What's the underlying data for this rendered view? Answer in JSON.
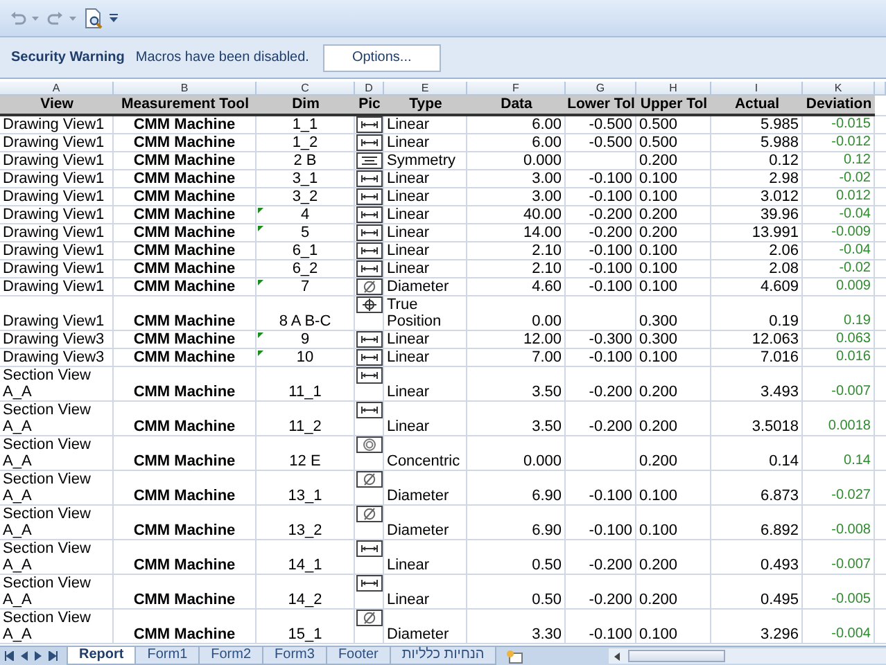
{
  "security_bar": {
    "title": "Security Warning",
    "message": "Macros have been disabled.",
    "button": "Options..."
  },
  "columns": [
    {
      "letter": "A",
      "heading": "View"
    },
    {
      "letter": "B",
      "heading": "Measurement Tool"
    },
    {
      "letter": "C",
      "heading": "Dim"
    },
    {
      "letter": "D",
      "heading": "Pic"
    },
    {
      "letter": "E",
      "heading": "Type"
    },
    {
      "letter": "F",
      "heading": "Data"
    },
    {
      "letter": "G",
      "heading": "Lower Tol"
    },
    {
      "letter": "H",
      "heading": "Upper Tol"
    },
    {
      "letter": "I",
      "heading": "Actual"
    },
    {
      "letter": "K",
      "heading": "Deviation"
    }
  ],
  "rows": [
    {
      "view": "Drawing View1",
      "tool": "CMM Machine",
      "dim": "1_1",
      "flag": false,
      "kind": "linear",
      "type": "Linear",
      "data": "6.00",
      "lower": "-0.500",
      "upper": "0.500",
      "actual": "5.985",
      "deviation": "-0.015"
    },
    {
      "view": "Drawing View1",
      "tool": "CMM Machine",
      "dim": "1_2",
      "flag": false,
      "kind": "linear",
      "type": "Linear",
      "data": "6.00",
      "lower": "-0.500",
      "upper": "0.500",
      "actual": "5.988",
      "deviation": "-0.012"
    },
    {
      "view": "Drawing View1",
      "tool": "CMM Machine",
      "dim": "2 B",
      "flag": false,
      "kind": "symmetry",
      "type": "Symmetry",
      "data": "0.000",
      "upper": "0.200",
      "actual": "0.12",
      "deviation": "0.12"
    },
    {
      "view": "Drawing View1",
      "tool": "CMM Machine",
      "dim": "3_1",
      "flag": false,
      "kind": "linear",
      "type": "Linear",
      "data": "3.00",
      "lower": "-0.100",
      "upper": "0.100",
      "actual": "2.98",
      "deviation": "-0.02"
    },
    {
      "view": "Drawing View1",
      "tool": "CMM Machine",
      "dim": "3_2",
      "flag": false,
      "kind": "linear",
      "type": "Linear",
      "data": "3.00",
      "lower": "-0.100",
      "upper": "0.100",
      "actual": "3.012",
      "deviation": "0.012"
    },
    {
      "view": "Drawing View1",
      "tool": "CMM Machine",
      "dim": "4",
      "flag": true,
      "kind": "linear",
      "type": "Linear",
      "data": "40.00",
      "lower": "-0.200",
      "upper": "0.200",
      "actual": "39.96",
      "deviation": "-0.04"
    },
    {
      "view": "Drawing View1",
      "tool": "CMM Machine",
      "dim": "5",
      "flag": true,
      "kind": "linear",
      "type": "Linear",
      "data": "14.00",
      "lower": "-0.200",
      "upper": "0.200",
      "actual": "13.991",
      "deviation": "-0.009"
    },
    {
      "view": "Drawing View1",
      "tool": "CMM Machine",
      "dim": "6_1",
      "flag": false,
      "kind": "linear",
      "type": "Linear",
      "data": "2.10",
      "lower": "-0.100",
      "upper": "0.100",
      "actual": "2.06",
      "deviation": "-0.04"
    },
    {
      "view": "Drawing View1",
      "tool": "CMM Machine",
      "dim": "6_2",
      "flag": false,
      "kind": "linear",
      "type": "Linear",
      "data": "2.10",
      "lower": "-0.100",
      "upper": "0.100",
      "actual": "2.08",
      "deviation": "-0.02"
    },
    {
      "view": "Drawing View1",
      "tool": "CMM Machine",
      "dim": "7",
      "flag": true,
      "kind": "diameter",
      "type": "Diameter",
      "data": "4.60",
      "lower": "-0.100",
      "upper": "0.100",
      "actual": "4.609",
      "deviation": "0.009"
    },
    {
      "view": "Drawing View1",
      "tool": "CMM Machine",
      "dim": "8 A B-C",
      "flag": false,
      "kind": "position",
      "type": "True Position",
      "data": "0.00",
      "upper": "0.300",
      "actual": "0.19",
      "deviation": "0.19"
    },
    {
      "view": "Drawing View3",
      "tool": "CMM Machine",
      "dim": "9",
      "flag": true,
      "kind": "linear",
      "type": "Linear",
      "data": "12.00",
      "lower": "-0.300",
      "upper": "0.300",
      "actual": "12.063",
      "deviation": "0.063"
    },
    {
      "view": "Drawing View3",
      "tool": "CMM Machine",
      "dim": "10",
      "flag": true,
      "kind": "linear",
      "type": "Linear",
      "data": "7.00",
      "lower": "-0.100",
      "upper": "0.100",
      "actual": "7.016",
      "deviation": "0.016"
    },
    {
      "view": "Section View A_A",
      "tool": "CMM Machine",
      "dim": "11_1",
      "flag": false,
      "kind": "linear",
      "type": "Linear",
      "data": "3.50",
      "lower": "-0.200",
      "upper": "0.200",
      "actual": "3.493",
      "deviation": "-0.007"
    },
    {
      "view": "Section View A_A",
      "tool": "CMM Machine",
      "dim": "11_2",
      "flag": false,
      "kind": "linear",
      "type": "Linear",
      "data": "3.50",
      "lower": "-0.200",
      "upper": "0.200",
      "actual": "3.5018",
      "deviation": "0.0018"
    },
    {
      "view": "Section View A_A",
      "tool": "CMM Machine",
      "dim": "12 E",
      "flag": false,
      "kind": "concentric",
      "type": "Concentric",
      "data": "0.000",
      "upper": "0.200",
      "actual": "0.14",
      "deviation": "0.14"
    },
    {
      "view": "Section View A_A",
      "tool": "CMM Machine",
      "dim": "13_1",
      "flag": false,
      "kind": "diameter",
      "type": "Diameter",
      "data": "6.90",
      "lower": "-0.100",
      "upper": "0.100",
      "actual": "6.873",
      "deviation": "-0.027"
    },
    {
      "view": "Section View A_A",
      "tool": "CMM Machine",
      "dim": "13_2",
      "flag": false,
      "kind": "diameter",
      "type": "Diameter",
      "data": "6.90",
      "lower": "-0.100",
      "upper": "0.100",
      "actual": "6.892",
      "deviation": "-0.008"
    },
    {
      "view": "Section View A_A",
      "tool": "CMM Machine",
      "dim": "14_1",
      "flag": false,
      "kind": "linear",
      "type": "Linear",
      "data": "0.50",
      "lower": "-0.200",
      "upper": "0.200",
      "actual": "0.493",
      "deviation": "-0.007"
    },
    {
      "view": "Section View A_A",
      "tool": "CMM Machine",
      "dim": "14_2",
      "flag": false,
      "kind": "linear",
      "type": "Linear",
      "data": "0.50",
      "lower": "-0.200",
      "upper": "0.200",
      "actual": "0.495",
      "deviation": "-0.005"
    },
    {
      "view": "Section View A_A",
      "tool": "CMM Machine",
      "dim": "15_1",
      "flag": false,
      "kind": "diameter",
      "type": "Diameter",
      "data": "3.30",
      "lower": "-0.100",
      "upper": "0.100",
      "actual": "3.296",
      "deviation": "-0.004"
    }
  ],
  "sheet_tabs": [
    {
      "label": "Report",
      "selected": true
    },
    {
      "label": "Form1",
      "selected": false
    },
    {
      "label": "Form2",
      "selected": false
    },
    {
      "label": "Form3",
      "selected": false
    },
    {
      "label": "Footer",
      "selected": false
    },
    {
      "label": "הנחיות כלליות",
      "selected": false
    }
  ]
}
